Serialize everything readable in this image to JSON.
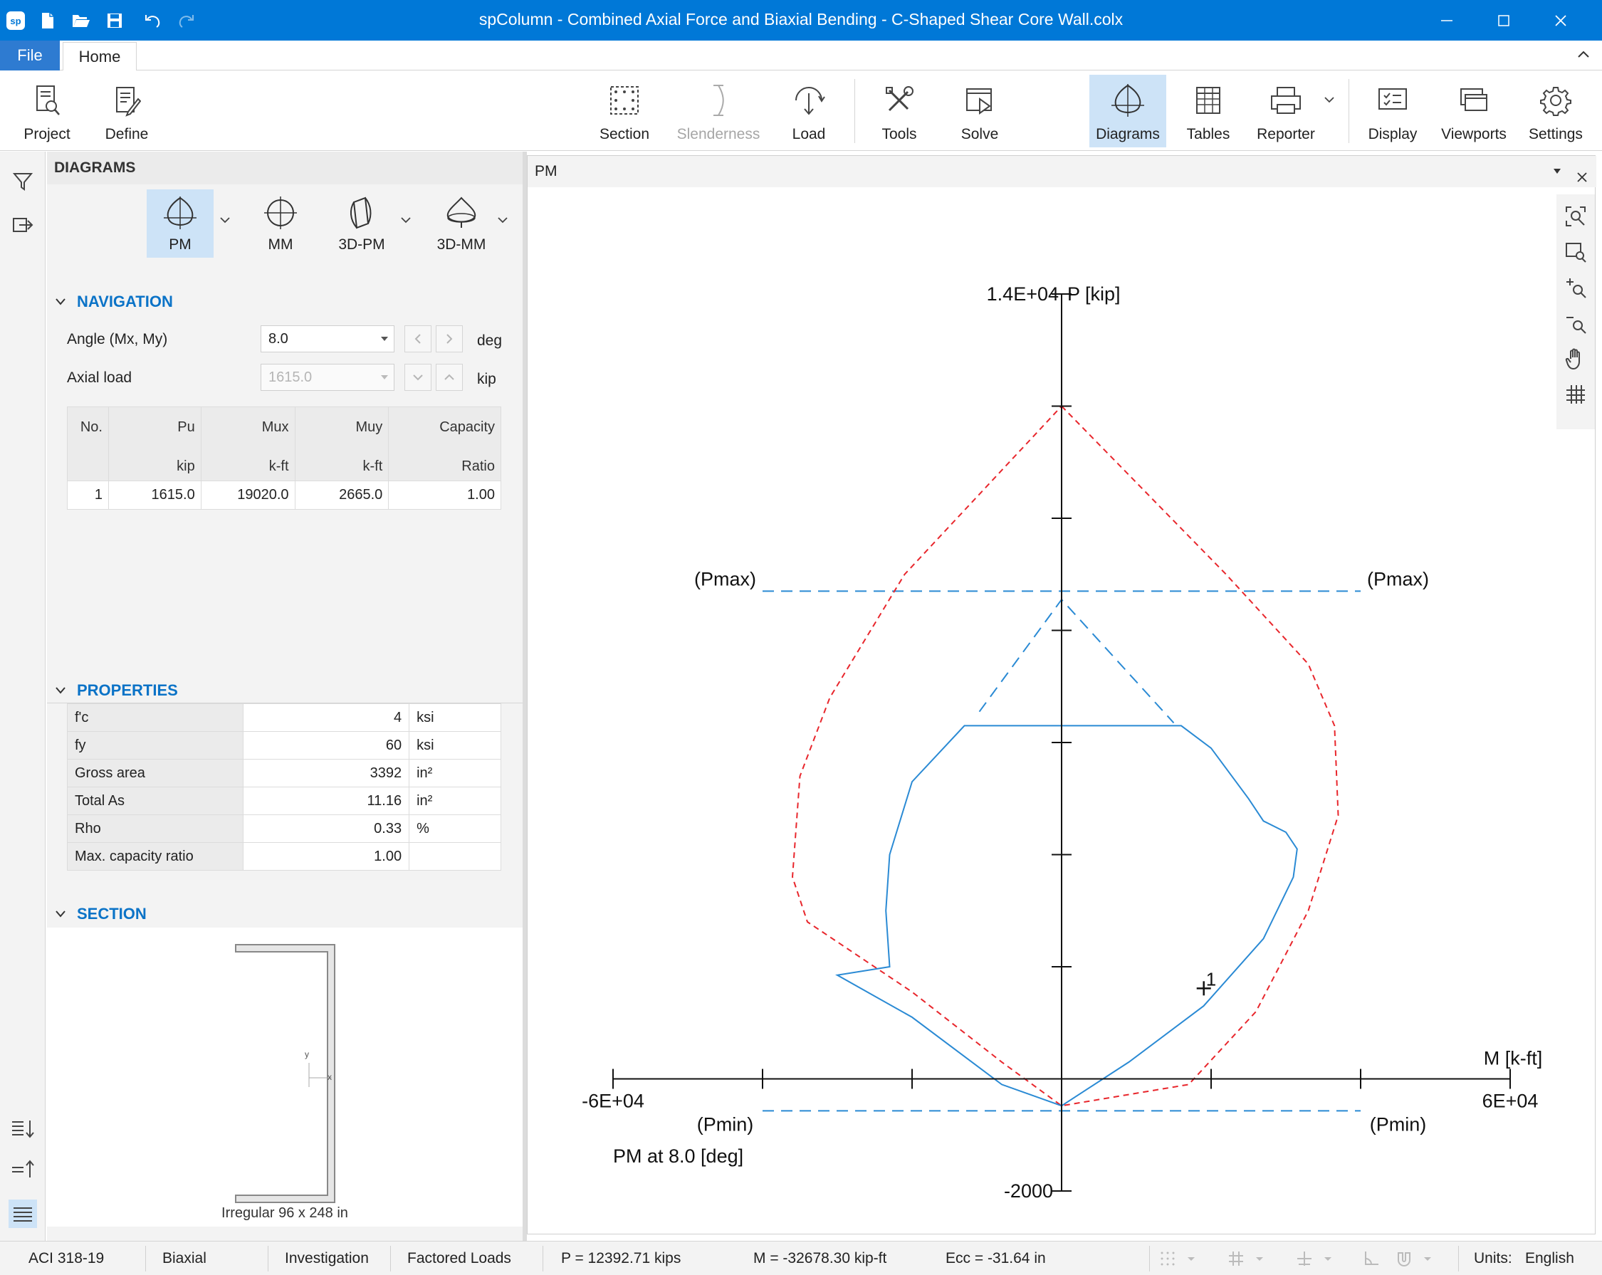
{
  "app": {
    "title": "spColumn - Combined Axial Force and Biaxial Bending - C-Shaped Shear Core Wall.colx",
    "logo": "sp"
  },
  "tabs": {
    "file": "File",
    "home": "Home"
  },
  "ribbon": {
    "project": "Project",
    "define": "Define",
    "section": "Section",
    "slenderness": "Slenderness",
    "load": "Load",
    "tools": "Tools",
    "solve": "Solve",
    "diagrams": "Diagrams",
    "tables": "Tables",
    "reporter": "Reporter",
    "display": "Display",
    "viewports": "Viewports",
    "settings": "Settings"
  },
  "panel": {
    "header": "DIAGRAMS",
    "diagram_types": [
      "PM",
      "MM",
      "3D-PM",
      "3D-MM"
    ],
    "navigation": {
      "title": "NAVIGATION",
      "angle_label": "Angle (Mx, My)",
      "angle_value": "8.0",
      "angle_unit": "deg",
      "axial_label": "Axial load",
      "axial_value": "1615.0",
      "axial_unit": "kip"
    },
    "results_table": {
      "headers": [
        "No.",
        "Pu",
        "Mux",
        "Muy",
        "Capacity"
      ],
      "units": [
        "",
        "kip",
        "k-ft",
        "k-ft",
        "Ratio"
      ],
      "rows": [
        [
          "1",
          "1615.0",
          "19020.0",
          "2665.0",
          "1.00"
        ]
      ]
    },
    "properties": {
      "title": "PROPERTIES",
      "rows": [
        {
          "key": "f'c",
          "value": "4",
          "unit": "ksi"
        },
        {
          "key": "fy",
          "value": "60",
          "unit": "ksi"
        },
        {
          "key": "Gross area",
          "value": "3392",
          "unit": "in²"
        },
        {
          "key": "Total As",
          "value": "11.16",
          "unit": "in²"
        },
        {
          "key": "Rho",
          "value": "0.33",
          "unit": "%"
        },
        {
          "key": "Max. capacity ratio",
          "value": "1.00",
          "unit": ""
        }
      ]
    },
    "section": {
      "title": "SECTION",
      "caption": "Irregular 96 x 248 in",
      "axis_y": "y",
      "axis_x": "x"
    }
  },
  "viewport": {
    "title": "PM"
  },
  "chart_data": {
    "type": "line",
    "title": "PM at 8.0 [deg]",
    "xlabel": "M [k-ft]",
    "ylabel": "P [kip]",
    "xlim": [
      -60000,
      60000
    ],
    "ylim": [
      -2000,
      14000
    ],
    "x_tick_labels": {
      "min": "-6E+04",
      "max": "6E+04"
    },
    "y_tick_labels": {
      "min": "-2000",
      "max": "1.4E+04"
    },
    "pmax_label": "(Pmax)",
    "pmin_label": "(Pmin)",
    "pmax_value": 8700,
    "pmin_value": -570,
    "series": [
      {
        "style": "dashed",
        "color": "#e8262c",
        "points": [
          [
            0,
            12000
          ],
          [
            22000,
            9000
          ],
          [
            33000,
            7400
          ],
          [
            36500,
            6300
          ],
          [
            37000,
            4700
          ],
          [
            33000,
            3000
          ],
          [
            26000,
            1200
          ],
          [
            17000,
            -100
          ],
          [
            0,
            -480
          ],
          [
            -8000,
            300
          ],
          [
            -20000,
            1550
          ],
          [
            -34000,
            2800
          ],
          [
            -36000,
            3600
          ],
          [
            -35000,
            5400
          ],
          [
            -31000,
            6800
          ],
          [
            -21000,
            9000
          ],
          [
            0,
            12000
          ]
        ]
      },
      {
        "style": "solid",
        "color": "#2a8ad4",
        "points": [
          [
            0,
            -480
          ],
          [
            9000,
            300
          ],
          [
            19000,
            1300
          ],
          [
            27000,
            2500
          ],
          [
            31000,
            3600
          ],
          [
            31500,
            4100
          ],
          [
            30000,
            4400
          ],
          [
            27000,
            4600
          ],
          [
            25000,
            5000
          ],
          [
            20000,
            5900
          ],
          [
            16000,
            6300
          ],
          [
            -13000,
            6300
          ],
          [
            -20000,
            5300
          ],
          [
            -23000,
            4000
          ],
          [
            -23500,
            3000
          ],
          [
            -23000,
            2000
          ],
          [
            -30000,
            1850
          ],
          [
            -20000,
            1100
          ],
          [
            -8000,
            -100
          ],
          [
            0,
            -480
          ]
        ]
      },
      {
        "style": "dashed",
        "color": "#2a8ad4",
        "points": [
          [
            -11000,
            6550
          ],
          [
            0,
            8550
          ],
          [
            15000,
            6350
          ]
        ]
      }
    ],
    "point_load": {
      "label": "1",
      "x": 19020,
      "y": 1615
    }
  },
  "status": {
    "code": "ACI 318-19",
    "mode": "Biaxial",
    "analysis": "Investigation",
    "loads": "Factored Loads",
    "p_readout": "P = 12392.71 kips",
    "m_readout": "M = -32678.30 kip-ft",
    "ecc_readout": "Ecc = -31.64 in",
    "units_label": "Units:",
    "units_value": "English"
  },
  "colors": {
    "titlebar": "#0078d7",
    "accent": "#0b73c7",
    "active_bg": "#cde3f7",
    "capacity_red": "#e8262c",
    "diagram_blue": "#2a8ad4"
  }
}
